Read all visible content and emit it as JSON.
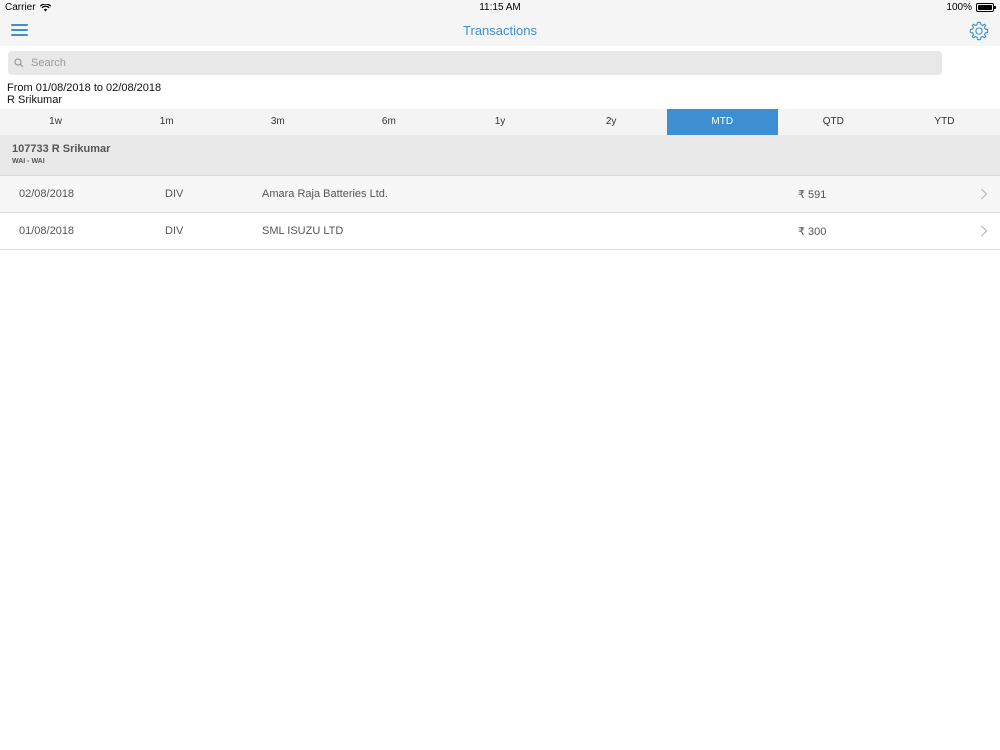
{
  "status_bar": {
    "carrier": "Carrier",
    "time": "11:15 AM",
    "battery": "100%"
  },
  "nav": {
    "title": "Transactions",
    "menu_icon": "hamburger-menu-icon",
    "settings_icon": "gear-icon"
  },
  "search": {
    "placeholder": "Search",
    "value": ""
  },
  "range": {
    "text": "From 01/08/2018 to 02/08/2018",
    "client": "R Srikumar"
  },
  "periods": {
    "selected": "MTD",
    "items": [
      "1w",
      "1m",
      "3m",
      "6m",
      "1y",
      "2y",
      "MTD",
      "QTD",
      "YTD"
    ]
  },
  "account": {
    "name": "107733 R Srikumar",
    "sub": "WAI - WAI"
  },
  "transactions": [
    {
      "date": "02/08/2018",
      "type": "DIV",
      "name": "Amara Raja Batteries Ltd.",
      "amount": "₹ 591"
    },
    {
      "date": "01/08/2018",
      "type": "DIV",
      "name": "SML ISUZU LTD",
      "amount": "₹ 300"
    }
  ],
  "colors": {
    "accent": "#3d8fd1",
    "header_bg": "#f5f5f5",
    "account_bg": "#e9e9e9"
  }
}
